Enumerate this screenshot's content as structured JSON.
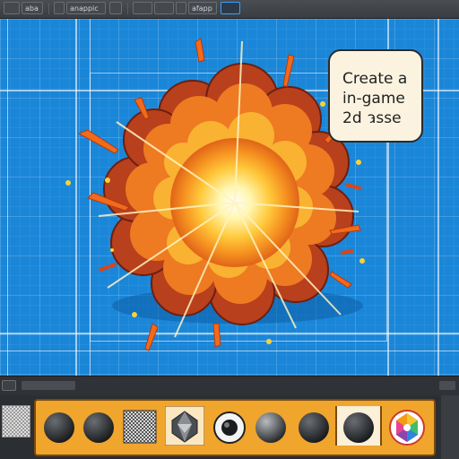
{
  "toolbar": {
    "buttons": [
      {
        "label": "",
        "active": false
      },
      {
        "label": "aba",
        "active": false
      },
      {
        "label": "",
        "active": false
      },
      {
        "label": "anappic",
        "active": false
      },
      {
        "label": "",
        "active": false
      },
      {
        "label": "",
        "active": false
      },
      {
        "label": "",
        "active": false
      },
      {
        "label": "",
        "active": false
      },
      {
        "label": "afapp",
        "active": false
      },
      {
        "label": "",
        "active": true
      }
    ]
  },
  "canvas": {
    "background": "#1a86d8",
    "asset": "explosion",
    "bubble_lines": [
      "Create a",
      "in-game",
      "2d  asse"
    ]
  },
  "palette": {
    "accent": "#f0a52c",
    "slots": [
      {
        "icon": "dark-sphere-icon"
      },
      {
        "icon": "dark-sphere-icon"
      },
      {
        "icon": "checker-texture-icon"
      },
      {
        "icon": "faceted-gem-icon"
      },
      {
        "icon": "eyeball-sphere-icon"
      },
      {
        "icon": "metal-sphere-icon"
      },
      {
        "icon": "dark-sphere-icon"
      },
      {
        "icon": "selected-sphere-icon"
      },
      {
        "icon": "rainbow-gem-icon"
      }
    ]
  }
}
